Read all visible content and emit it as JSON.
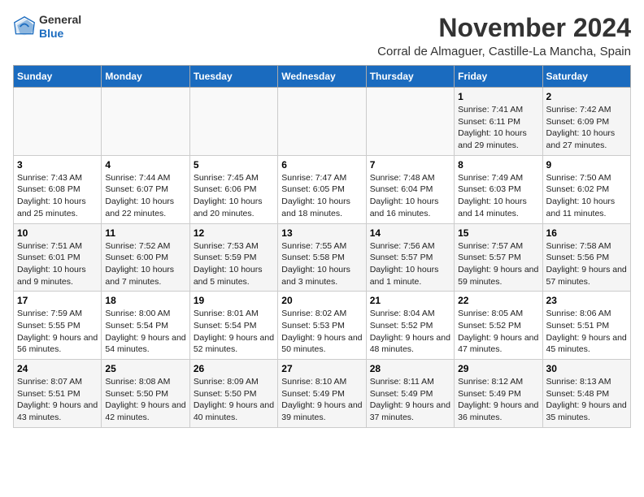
{
  "header": {
    "logo_general": "General",
    "logo_blue": "Blue",
    "month_title": "November 2024",
    "location": "Corral de Almaguer, Castille-La Mancha, Spain"
  },
  "calendar": {
    "weekdays": [
      "Sunday",
      "Monday",
      "Tuesday",
      "Wednesday",
      "Thursday",
      "Friday",
      "Saturday"
    ],
    "weeks": [
      [
        {
          "day": "",
          "info": ""
        },
        {
          "day": "",
          "info": ""
        },
        {
          "day": "",
          "info": ""
        },
        {
          "day": "",
          "info": ""
        },
        {
          "day": "",
          "info": ""
        },
        {
          "day": "1",
          "info": "Sunrise: 7:41 AM\nSunset: 6:11 PM\nDaylight: 10 hours and 29 minutes."
        },
        {
          "day": "2",
          "info": "Sunrise: 7:42 AM\nSunset: 6:09 PM\nDaylight: 10 hours and 27 minutes."
        }
      ],
      [
        {
          "day": "3",
          "info": "Sunrise: 7:43 AM\nSunset: 6:08 PM\nDaylight: 10 hours and 25 minutes."
        },
        {
          "day": "4",
          "info": "Sunrise: 7:44 AM\nSunset: 6:07 PM\nDaylight: 10 hours and 22 minutes."
        },
        {
          "day": "5",
          "info": "Sunrise: 7:45 AM\nSunset: 6:06 PM\nDaylight: 10 hours and 20 minutes."
        },
        {
          "day": "6",
          "info": "Sunrise: 7:47 AM\nSunset: 6:05 PM\nDaylight: 10 hours and 18 minutes."
        },
        {
          "day": "7",
          "info": "Sunrise: 7:48 AM\nSunset: 6:04 PM\nDaylight: 10 hours and 16 minutes."
        },
        {
          "day": "8",
          "info": "Sunrise: 7:49 AM\nSunset: 6:03 PM\nDaylight: 10 hours and 14 minutes."
        },
        {
          "day": "9",
          "info": "Sunrise: 7:50 AM\nSunset: 6:02 PM\nDaylight: 10 hours and 11 minutes."
        }
      ],
      [
        {
          "day": "10",
          "info": "Sunrise: 7:51 AM\nSunset: 6:01 PM\nDaylight: 10 hours and 9 minutes."
        },
        {
          "day": "11",
          "info": "Sunrise: 7:52 AM\nSunset: 6:00 PM\nDaylight: 10 hours and 7 minutes."
        },
        {
          "day": "12",
          "info": "Sunrise: 7:53 AM\nSunset: 5:59 PM\nDaylight: 10 hours and 5 minutes."
        },
        {
          "day": "13",
          "info": "Sunrise: 7:55 AM\nSunset: 5:58 PM\nDaylight: 10 hours and 3 minutes."
        },
        {
          "day": "14",
          "info": "Sunrise: 7:56 AM\nSunset: 5:57 PM\nDaylight: 10 hours and 1 minute."
        },
        {
          "day": "15",
          "info": "Sunrise: 7:57 AM\nSunset: 5:57 PM\nDaylight: 9 hours and 59 minutes."
        },
        {
          "day": "16",
          "info": "Sunrise: 7:58 AM\nSunset: 5:56 PM\nDaylight: 9 hours and 57 minutes."
        }
      ],
      [
        {
          "day": "17",
          "info": "Sunrise: 7:59 AM\nSunset: 5:55 PM\nDaylight: 9 hours and 56 minutes."
        },
        {
          "day": "18",
          "info": "Sunrise: 8:00 AM\nSunset: 5:54 PM\nDaylight: 9 hours and 54 minutes."
        },
        {
          "day": "19",
          "info": "Sunrise: 8:01 AM\nSunset: 5:54 PM\nDaylight: 9 hours and 52 minutes."
        },
        {
          "day": "20",
          "info": "Sunrise: 8:02 AM\nSunset: 5:53 PM\nDaylight: 9 hours and 50 minutes."
        },
        {
          "day": "21",
          "info": "Sunrise: 8:04 AM\nSunset: 5:52 PM\nDaylight: 9 hours and 48 minutes."
        },
        {
          "day": "22",
          "info": "Sunrise: 8:05 AM\nSunset: 5:52 PM\nDaylight: 9 hours and 47 minutes."
        },
        {
          "day": "23",
          "info": "Sunrise: 8:06 AM\nSunset: 5:51 PM\nDaylight: 9 hours and 45 minutes."
        }
      ],
      [
        {
          "day": "24",
          "info": "Sunrise: 8:07 AM\nSunset: 5:51 PM\nDaylight: 9 hours and 43 minutes."
        },
        {
          "day": "25",
          "info": "Sunrise: 8:08 AM\nSunset: 5:50 PM\nDaylight: 9 hours and 42 minutes."
        },
        {
          "day": "26",
          "info": "Sunrise: 8:09 AM\nSunset: 5:50 PM\nDaylight: 9 hours and 40 minutes."
        },
        {
          "day": "27",
          "info": "Sunrise: 8:10 AM\nSunset: 5:49 PM\nDaylight: 9 hours and 39 minutes."
        },
        {
          "day": "28",
          "info": "Sunrise: 8:11 AM\nSunset: 5:49 PM\nDaylight: 9 hours and 37 minutes."
        },
        {
          "day": "29",
          "info": "Sunrise: 8:12 AM\nSunset: 5:49 PM\nDaylight: 9 hours and 36 minutes."
        },
        {
          "day": "30",
          "info": "Sunrise: 8:13 AM\nSunset: 5:48 PM\nDaylight: 9 hours and 35 minutes."
        }
      ]
    ]
  }
}
